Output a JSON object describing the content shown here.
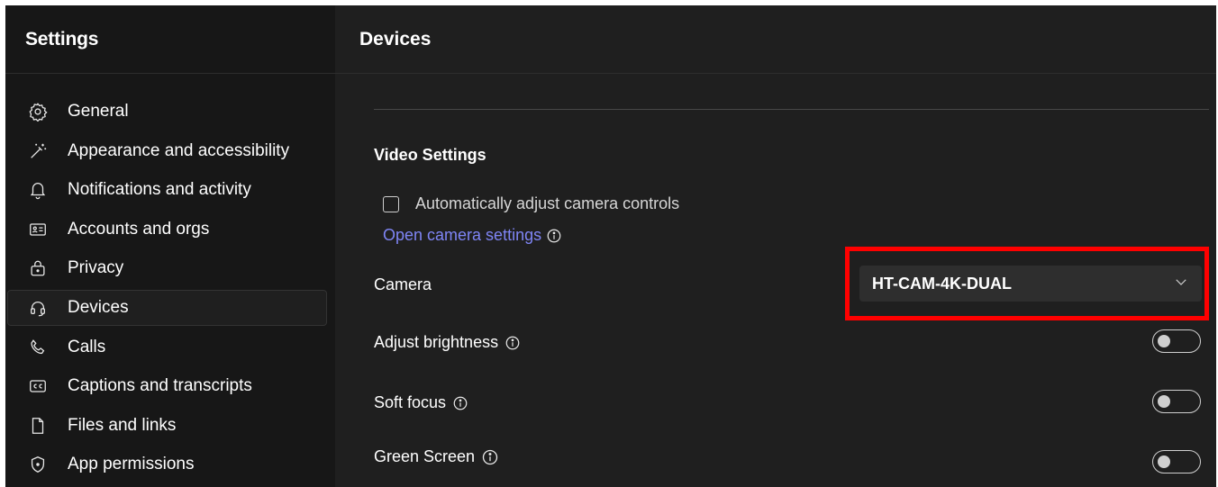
{
  "sidebar": {
    "title": "Settings",
    "items": [
      {
        "label": "General",
        "icon": "gear-icon"
      },
      {
        "label": "Appearance and accessibility",
        "icon": "magic-wand-icon"
      },
      {
        "label": "Notifications and activity",
        "icon": "bell-icon"
      },
      {
        "label": "Accounts and orgs",
        "icon": "id-card-icon"
      },
      {
        "label": "Privacy",
        "icon": "lock-icon"
      },
      {
        "label": "Devices",
        "icon": "headset-icon",
        "active": true
      },
      {
        "label": "Calls",
        "icon": "phone-icon"
      },
      {
        "label": "Captions and transcripts",
        "icon": "cc-icon"
      },
      {
        "label": "Files and links",
        "icon": "document-icon"
      },
      {
        "label": "App permissions",
        "icon": "shield-icon"
      }
    ]
  },
  "main": {
    "title": "Devices",
    "section_title": "Video Settings",
    "auto_adjust_label": "Automatically adjust camera controls",
    "auto_adjust_checked": false,
    "open_camera_link": "Open camera settings",
    "camera_label": "Camera",
    "camera_value": "HT-CAM-4K-DUAL",
    "brightness_label": "Adjust brightness",
    "brightness_on": false,
    "soft_focus_label": "Soft focus",
    "soft_focus_on": false,
    "green_screen_label": "Green Screen",
    "green_screen_on": false
  },
  "colors": {
    "link": "#7f85f5",
    "highlight": "#ff0000",
    "background": "#1f1f1f",
    "sidebar": "#171717"
  }
}
